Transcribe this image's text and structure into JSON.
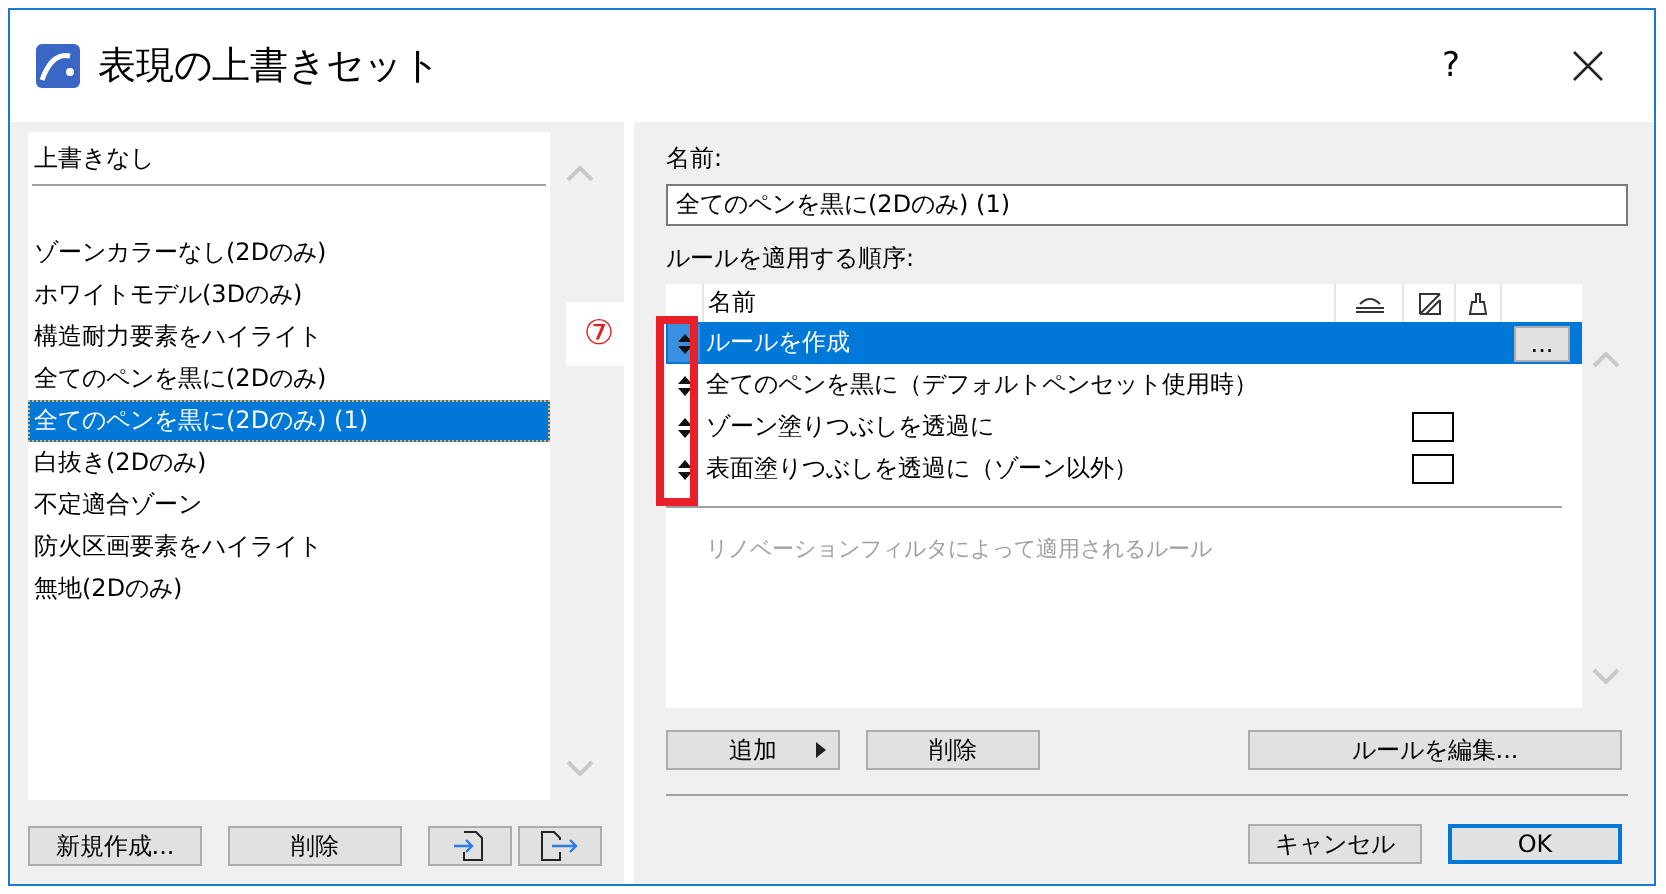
{
  "window": {
    "title": "表現の上書きセット",
    "help": "?"
  },
  "sets": {
    "default_item": {
      "label": "上書きなし",
      "selected": false
    },
    "items": [
      {
        "label": "ゾーンカラーなし(2Dのみ)",
        "selected": false
      },
      {
        "label": "ホワイトモデル(3Dのみ)",
        "selected": false
      },
      {
        "label": "構造耐力要素をハイライト",
        "selected": false
      },
      {
        "label": "全てのペンを黒に(2Dのみ)",
        "selected": false
      },
      {
        "label": "全てのペンを黒に(2Dのみ) (1)",
        "selected": true
      },
      {
        "label": "白抜き(2Dのみ)",
        "selected": false
      },
      {
        "label": "不定適合ゾーン",
        "selected": false
      },
      {
        "label": "防火区画要素をハイライト",
        "selected": false
      },
      {
        "label": "無地(2Dのみ)",
        "selected": false
      }
    ],
    "buttons": {
      "new": "新規作成...",
      "delete": "削除"
    }
  },
  "name_label": "名前:",
  "name_value": "全てのペンを黒に(2Dのみ) (1)",
  "order_label": "ルールを適用する順序:",
  "rules": {
    "header": "名前",
    "more_button": "...",
    "rows": [
      {
        "name": "ルールを作成",
        "selected": true,
        "swatch": false
      },
      {
        "name": "全てのペンを黒に（デフォルトペンセット使用時）",
        "selected": false,
        "swatch": false
      },
      {
        "name": "ゾーン塗りつぶしを透過に",
        "selected": false,
        "swatch": true
      },
      {
        "name": "表面塗りつぶしを透過に（ゾーン以外）",
        "selected": false,
        "swatch": true
      }
    ],
    "renovation_text": "リノベーションフィルタによって適用されるルール"
  },
  "rule_buttons": {
    "add": "追加",
    "delete": "削除",
    "edit": "ルールを編集..."
  },
  "dialog_buttons": {
    "cancel": "キャンセル",
    "ok": "OK"
  },
  "annotation": {
    "badge": "⑦"
  }
}
